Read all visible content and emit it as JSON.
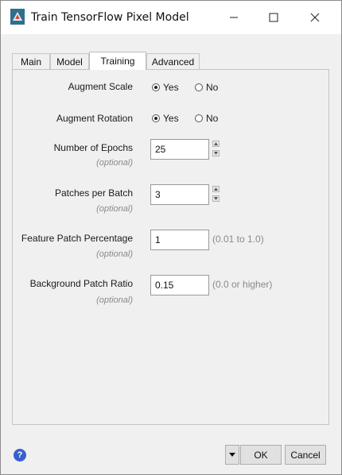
{
  "window": {
    "title": "Train TensorFlow Pixel Model",
    "icons": {
      "app": "tensorflow-app-icon",
      "minimize": "minimize-icon",
      "maximize": "maximize-icon",
      "close": "close-icon"
    }
  },
  "tabs": [
    {
      "label": "Main",
      "active": false
    },
    {
      "label": "Model",
      "active": false
    },
    {
      "label": "Training",
      "active": true
    },
    {
      "label": "Advanced",
      "active": false
    }
  ],
  "form": {
    "augment_scale": {
      "label": "Augment Scale",
      "yes": "Yes",
      "no": "No",
      "selected": "Yes"
    },
    "augment_rotation": {
      "label": "Augment Rotation",
      "yes": "Yes",
      "no": "No",
      "selected": "Yes"
    },
    "epochs": {
      "label": "Number of Epochs",
      "optional": "(optional)",
      "value": "25"
    },
    "patches": {
      "label": "Patches per Batch",
      "optional": "(optional)",
      "value": "3"
    },
    "feature_pct": {
      "label": "Feature Patch Percentage",
      "optional": "(optional)",
      "value": "1",
      "hint": "(0.01 to 1.0)"
    },
    "background_ratio": {
      "label": "Background Patch Ratio",
      "optional": "(optional)",
      "value": "0.15",
      "hint": "(0.0 or higher)"
    }
  },
  "footer": {
    "help_icon": "help-icon",
    "menu_icon": "dropdown-arrow-icon",
    "ok_label": "OK",
    "cancel_label": "Cancel"
  },
  "colors": {
    "help_icon": "#3a5fcd",
    "optional_text": "#8a8a8a"
  }
}
